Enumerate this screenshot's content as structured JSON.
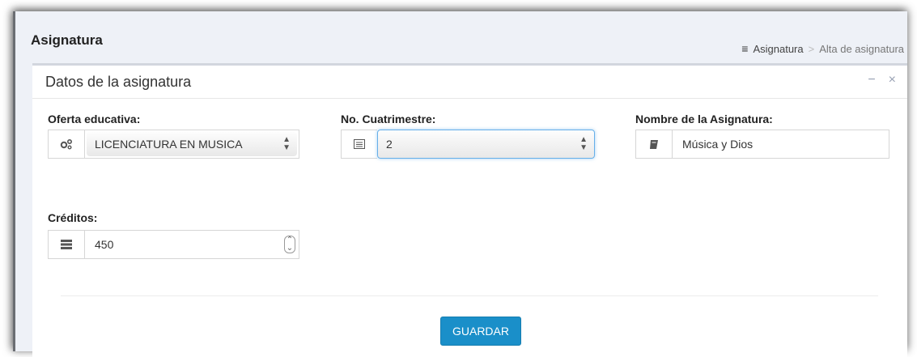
{
  "page": {
    "title": "Asignatura"
  },
  "breadcrumb": {
    "home_label": "Asignatura",
    "separator": ">",
    "current": "Alta de asignatura",
    "icon": "menu-icon"
  },
  "panel": {
    "title": "Datos de la asignatura",
    "minimize_symbol": "−",
    "close_symbol": "×"
  },
  "form": {
    "oferta": {
      "label": "Oferta educativa:",
      "value": "LICENCIATURA EN MUSICA",
      "icon": "cogs-icon"
    },
    "cuatrimestre": {
      "label": "No. Cuatrimestre:",
      "value": "2",
      "icon": "list-icon"
    },
    "nombre": {
      "label": "Nombre de la Asignatura:",
      "value": "Música y Dios",
      "icon": "book-icon"
    },
    "creditos": {
      "label": "Créditos:",
      "value": "450",
      "icon": "tasks-icon"
    }
  },
  "actions": {
    "save_label": "GUARDAR",
    "save_color": "#1a8fc9"
  },
  "colors": {
    "background": "#eef1f7",
    "panel_border": "#d2d6de",
    "focus": "#66afe9"
  }
}
